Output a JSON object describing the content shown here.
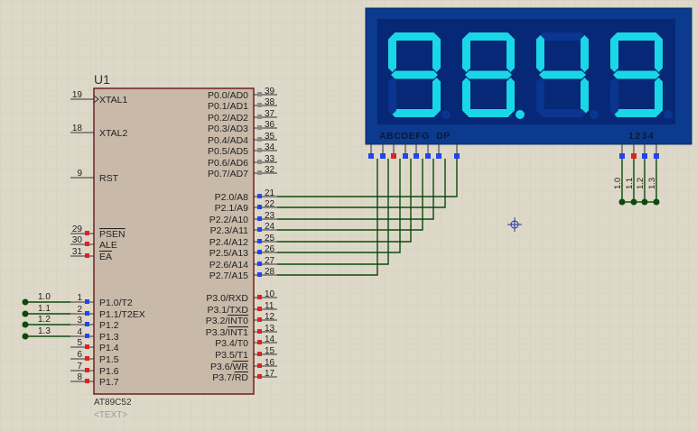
{
  "chip": {
    "ref": "U1",
    "part": "AT89C52",
    "text_placeholder": "<TEXT>",
    "left_pins": [
      {
        "num": "19",
        "label": "XTAL1",
        "overline": false
      },
      {
        "num": "18",
        "label": "XTAL2",
        "overline": false
      },
      {
        "num": "9",
        "label": "RST",
        "overline": false
      },
      {
        "num": "29",
        "label": "PSEN",
        "overline": true
      },
      {
        "num": "30",
        "label": "ALE",
        "overline": false
      },
      {
        "num": "31",
        "label": "EA",
        "overline": true
      },
      {
        "num": "1",
        "label": "P1.0/T2",
        "overline": false
      },
      {
        "num": "2",
        "label": "P1.1/T2EX",
        "overline": false
      },
      {
        "num": "3",
        "label": "P1.2",
        "overline": false
      },
      {
        "num": "4",
        "label": "P1.3",
        "overline": false
      },
      {
        "num": "5",
        "label": "P1.4",
        "overline": false
      },
      {
        "num": "6",
        "label": "P1.5",
        "overline": false
      },
      {
        "num": "7",
        "label": "P1.6",
        "overline": false
      },
      {
        "num": "8",
        "label": "P1.7",
        "overline": false
      }
    ],
    "right_pins": [
      {
        "num": "39",
        "label": "P0.0/AD0"
      },
      {
        "num": "38",
        "label": "P0.1/AD1"
      },
      {
        "num": "37",
        "label": "P0.2/AD2"
      },
      {
        "num": "36",
        "label": "P0.3/AD3"
      },
      {
        "num": "35",
        "label": "P0.4/AD4"
      },
      {
        "num": "34",
        "label": "P0.5/AD5"
      },
      {
        "num": "33",
        "label": "P0.6/AD6"
      },
      {
        "num": "32",
        "label": "P0.7/AD7"
      },
      {
        "num": "21",
        "label": "P2.0/A8"
      },
      {
        "num": "22",
        "label": "P2.1/A9"
      },
      {
        "num": "23",
        "label": "P2.2/A10"
      },
      {
        "num": "24",
        "label": "P2.3/A11"
      },
      {
        "num": "25",
        "label": "P2.4/A12"
      },
      {
        "num": "26",
        "label": "P2.5/A13"
      },
      {
        "num": "27",
        "label": "P2.6/A14"
      },
      {
        "num": "28",
        "label": "P2.7/A15"
      },
      {
        "num": "10",
        "label": "P3.0/RXD"
      },
      {
        "num": "11",
        "label": "P3.1/TXD"
      },
      {
        "num": "12",
        "label": "P3.2/INT0"
      },
      {
        "num": "13",
        "label": "P3.3/INT1"
      },
      {
        "num": "14",
        "label": "P3.4/T0"
      },
      {
        "num": "15",
        "label": "P3.5/T1"
      },
      {
        "num": "16",
        "label": "P3.6/WR"
      },
      {
        "num": "17",
        "label": "P3.7/RD"
      }
    ]
  },
  "display": {
    "digits": [
      "9",
      "8",
      "4",
      "9"
    ],
    "decimal_after_index": 1,
    "segment_pins_label": "ABCDEFG  DP",
    "digit_pins_label": "1234",
    "digit_net_labels": [
      "1.0",
      "1.1",
      "1.2",
      "1.3"
    ]
  },
  "p1_net_labels": [
    "1.0",
    "1.1",
    "1.2",
    "1.3"
  ],
  "colors": {
    "background": "#ddd8c8",
    "chip_body": "#c8b9a8",
    "chip_border": "#6e2020",
    "wire": "#0b4a0b",
    "display_frame": "#0b3a8e",
    "display_face": "#062876",
    "segment_on": "#19d7e6",
    "pin_blue": "#2244ee",
    "pin_red": "#dd2222",
    "pin_grey": "#8a8a8a"
  }
}
